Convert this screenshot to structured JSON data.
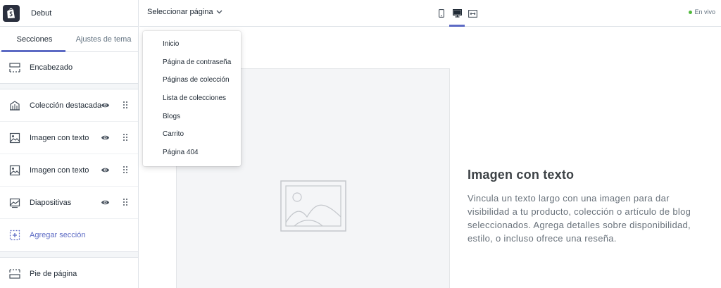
{
  "theme": {
    "name": "Debut"
  },
  "tabs": [
    {
      "label": "Secciones",
      "active": true
    },
    {
      "label": "Ajustes de tema",
      "active": false
    }
  ],
  "sections": {
    "header": {
      "label": "Encabezado",
      "icon": "header-layout-icon"
    },
    "items": [
      {
        "label": "Colección destacada",
        "icon": "collection-icon"
      },
      {
        "label": "Imagen con texto",
        "icon": "image-icon"
      },
      {
        "label": "Imagen con texto",
        "icon": "image-icon"
      },
      {
        "label": "Diapositivas",
        "icon": "slideshow-icon"
      }
    ],
    "add": {
      "label": "Agregar sección",
      "icon": "add-section-icon"
    },
    "footer": {
      "label": "Pie de página",
      "icon": "footer-layout-icon"
    }
  },
  "topbar": {
    "page_select_label": "Seleccionar página",
    "devices": [
      "mobile-icon",
      "desktop-icon",
      "fullwidth-icon"
    ],
    "active_device": "desktop-icon",
    "status": "En vivo"
  },
  "dropdown": {
    "items": [
      "Inicio",
      "Página de contraseña",
      "Páginas de colección",
      "Lista de colecciones",
      "Blogs",
      "Carrito",
      "Página 404"
    ]
  },
  "preview": {
    "title": "Imagen con texto",
    "body": "Vincula un texto largo con una imagen para dar visibilidad a tu producto, colección o artículo de blog seleccionados. Agrega detalles sobre disponibilidad, estilo, o incluso ofrece una reseña."
  },
  "colors": {
    "accent": "#5c6ac4",
    "live": "#50b83c",
    "brand": "#2a2f3e"
  }
}
